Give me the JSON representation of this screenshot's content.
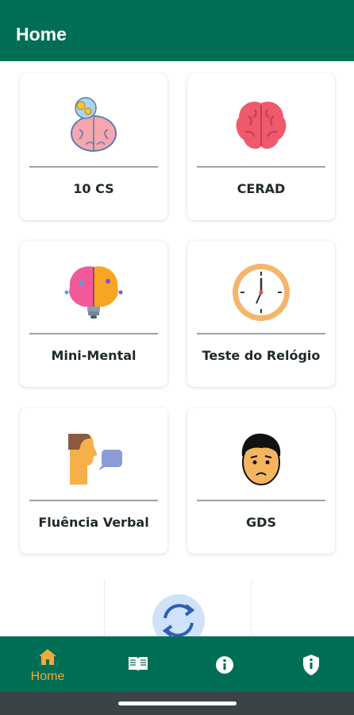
{
  "app_bar": {
    "title": "Home"
  },
  "cards": [
    {
      "label": "10 CS",
      "icon": "brain-gears-icon"
    },
    {
      "label": "CERAD",
      "icon": "brain-icon"
    },
    {
      "label": "Mini-Mental",
      "icon": "brain-lightbulb-icon"
    },
    {
      "label": "Teste do Relógio",
      "icon": "clock-icon"
    },
    {
      "label": "Fluência Verbal",
      "icon": "speaking-person-icon"
    },
    {
      "label": "GDS",
      "icon": "sad-face-icon"
    }
  ],
  "partial_card": {
    "icon": "refresh-icon"
  },
  "bottom_nav": {
    "items": [
      {
        "label": "Home",
        "icon": "home-icon",
        "active": true
      },
      {
        "icon": "book-icon"
      },
      {
        "icon": "info-icon"
      },
      {
        "icon": "shield-icon"
      }
    ],
    "active_color": "#f2a93b"
  },
  "colors": {
    "primary": "#006e55",
    "accent": "#f2a93b"
  }
}
